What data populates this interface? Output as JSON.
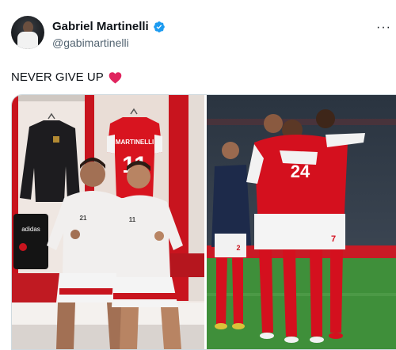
{
  "author": {
    "display_name": "Gabriel Martinelli",
    "handle": "@gabimartinelli"
  },
  "tweet": {
    "text": "NEVER GIVE UP"
  },
  "media": {
    "left_photo": {
      "shirt_name": "MARTINELLI",
      "shirt_number": "11",
      "player_a_number": "21",
      "player_b_number": "11",
      "bag_brand": "adidas"
    },
    "right_photo": {
      "jersey_number": "24",
      "jersey_number_2": "7",
      "shorts_number": "2"
    }
  },
  "colors": {
    "verified": "#1d9bf0",
    "heart": "#e0245e",
    "arsenal_red": "#d4101e"
  },
  "icons": [
    "verified-badge-icon",
    "more-icon",
    "heart-emoji-icon"
  ]
}
